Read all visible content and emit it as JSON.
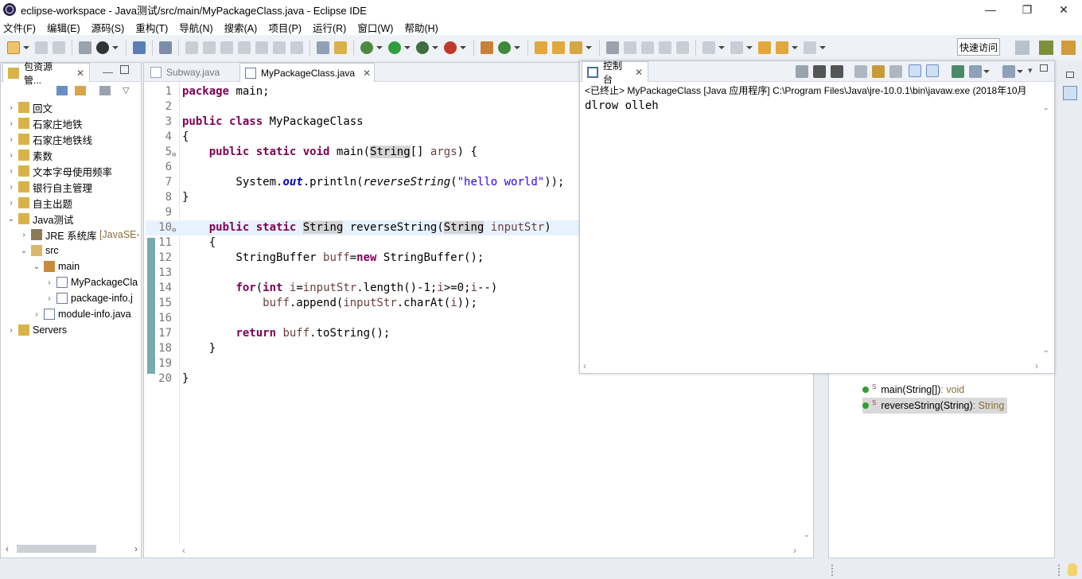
{
  "window": {
    "title": "eclipse-workspace - Java测试/src/main/MyPackageClass.java - Eclipse IDE",
    "minimize": "—",
    "maximize": "❐",
    "close": "✕"
  },
  "menu": [
    "文件(F)",
    "编辑(E)",
    "源码(S)",
    "重构(T)",
    "导航(N)",
    "搜索(A)",
    "项目(P)",
    "运行(R)",
    "窗口(W)",
    "帮助(H)"
  ],
  "toolbar": {
    "quick_access": "快速访问"
  },
  "package_explorer": {
    "tab_label": "包资源管...",
    "close": "✕",
    "items": [
      {
        "label": "回文"
      },
      {
        "label": "石家庄地铁"
      },
      {
        "label": "石家庄地铁线"
      },
      {
        "label": "素数"
      },
      {
        "label": "文本字母使用频率"
      },
      {
        "label": "银行自主管理"
      },
      {
        "label": "自主出题"
      },
      {
        "label": "Java测试"
      },
      {
        "label": "JRE 系统库",
        "suffix": "[JavaSE-"
      },
      {
        "label": "src"
      },
      {
        "label": "main"
      },
      {
        "label": "MyPackageCla"
      },
      {
        "label": "package-info.j"
      },
      {
        "label": "module-info.java"
      },
      {
        "label": "Servers"
      }
    ]
  },
  "editor": {
    "tabs": [
      {
        "label": "Subway.java"
      },
      {
        "label": "MyPackageClass.java",
        "close": "✕"
      }
    ],
    "line_numbers": [
      "1",
      "2",
      "3",
      "4",
      "5",
      "6",
      "7",
      "8",
      "9",
      "10",
      "11",
      "12",
      "13",
      "14",
      "15",
      "16",
      "17",
      "18",
      "19",
      "20"
    ]
  },
  "console": {
    "tab_label": "控制台",
    "close": "✕",
    "status": "<已终止> MyPackageClass [Java 应用程序] C:\\Program Files\\Java\\jre-10.0.1\\bin\\javaw.exe  (2018年10月",
    "output": "dlrow olleh"
  },
  "outline": {
    "items": [
      {
        "modifier": "S",
        "name": "main(String[])",
        "ret": " : void"
      },
      {
        "modifier": "S",
        "name": "reverseString(String)",
        "ret": " : String"
      }
    ]
  },
  "colors": {
    "keyword": "#7f0055",
    "string": "#2a00ff",
    "field": "#0000c0",
    "variable": "#6a3e3e",
    "change_ruler": "#5f9ea0"
  }
}
